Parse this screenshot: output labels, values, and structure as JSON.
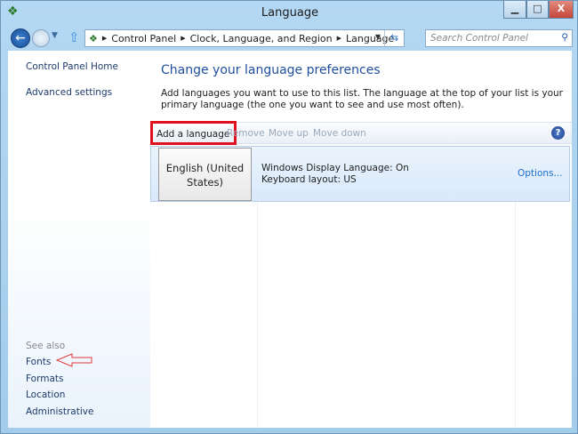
{
  "window": {
    "title": "Language",
    "minimize": "▁",
    "maximize": "□",
    "close": "X"
  },
  "nav": {
    "breadcrumb": [
      "Control Panel",
      "Clock, Language, and Region",
      "Language"
    ],
    "search_placeholder": "Search Control Panel"
  },
  "sidebar": {
    "links": [
      "Control Panel Home",
      "Advanced settings"
    ],
    "see_also_label": "See also",
    "see_also": [
      "Fonts",
      "Formats",
      "Location",
      "Administrative"
    ]
  },
  "main": {
    "title": "Change your language preferences",
    "description": "Add languages you want to use to this list. The language at the top of your list is your primary language (the one you want to see and use most often).",
    "toolbar": {
      "add": "Add a language",
      "remove": "Remove",
      "move_up": "Move up",
      "move_down": "Move down",
      "help": "?"
    },
    "languages": [
      {
        "name": "English (United States)",
        "display": "Windows Display Language: On",
        "keyboard": "Keyboard layout: US",
        "options": "Options..."
      }
    ]
  },
  "colors": {
    "accent": "#1e4f9c",
    "highlight": "#e0101e"
  }
}
